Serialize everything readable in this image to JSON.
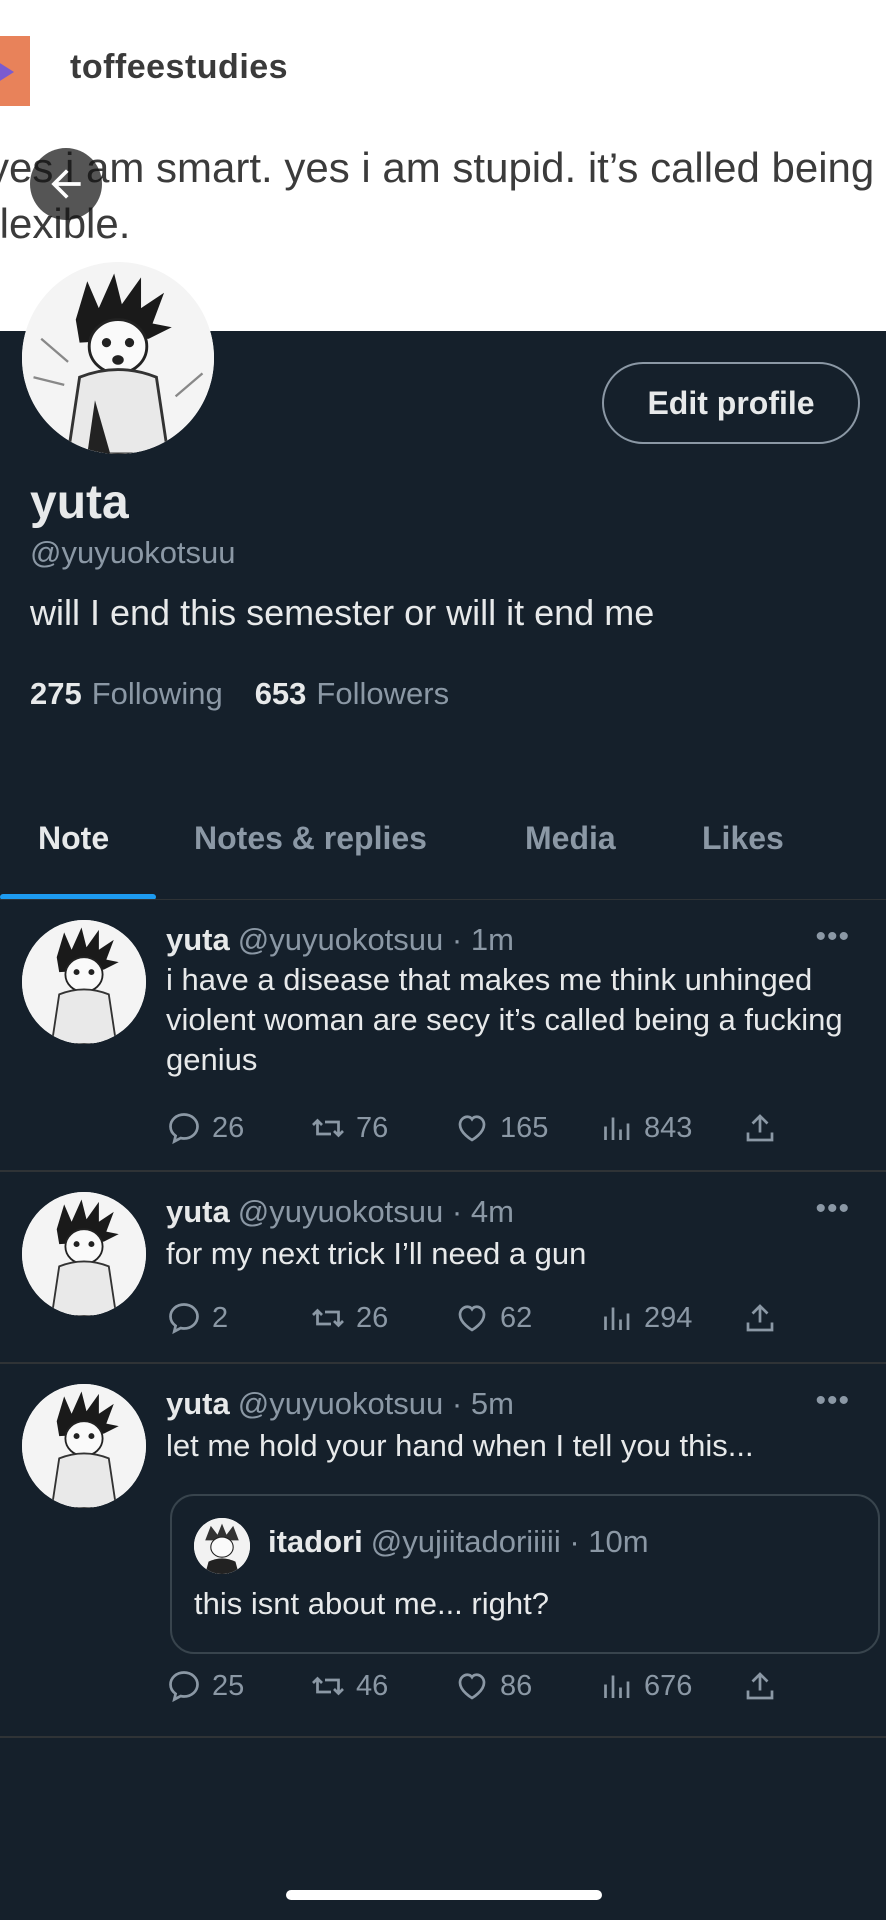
{
  "banner": {
    "username": "toffeestudies",
    "text": "yes i am smart. yes i am stupid. it’s called being flexible."
  },
  "profile": {
    "name": "yuta",
    "handle": "@yuyuokotsuu",
    "bio": "will I end this semester or will it end me",
    "following_count": "275",
    "following_label": "Following",
    "followers_count": "653",
    "followers_label": "Followers",
    "edit_button": "Edit profile"
  },
  "tabs": [
    {
      "label": "Note"
    },
    {
      "label": "Notes & replies"
    },
    {
      "label": "Media"
    },
    {
      "label": "Likes"
    }
  ],
  "posts": [
    {
      "name": "yuta",
      "meta": "@yuyuokotsuu · 1m",
      "text": "i have a disease that makes me think unhinged violent woman are secy it’s called being a fucking genius",
      "replies": "26",
      "reposts": "76",
      "likes": "165",
      "views": "843"
    },
    {
      "name": "yuta",
      "meta": "@yuyuokotsuu · 4m",
      "text": "for my next trick I’ll need a gun",
      "replies": "2",
      "reposts": "26",
      "likes": "62",
      "views": "294"
    },
    {
      "name": "yuta",
      "meta": "@yuyuokotsuu · 5m",
      "text": "let me hold your hand when I tell you this...",
      "quote": {
        "name": "itadori",
        "meta": "@yujiitadoriiiii · 10m",
        "text": "this isnt about me... right?"
      },
      "replies": "25",
      "reposts": "46",
      "likes": "86",
      "views": "676"
    }
  ],
  "more_label": "•••",
  "colors": {
    "background": "#15202b",
    "accent": "#1d9bf0",
    "secondary_text": "#8b98a5"
  }
}
